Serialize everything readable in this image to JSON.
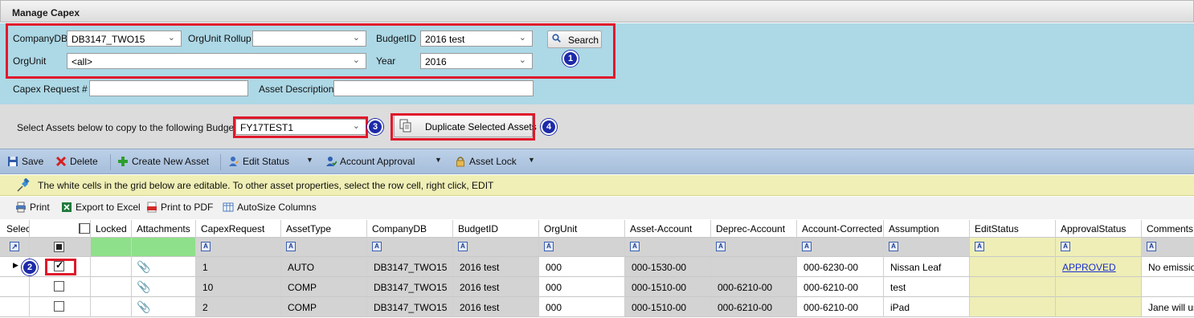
{
  "window": {
    "title": "Manage Capex"
  },
  "filters": {
    "company_db_label": "CompanyDB",
    "company_db_value": "DB3147_TWO15",
    "orgunit_rollup_label": "OrgUnit Rollup",
    "orgunit_rollup_value": "",
    "budget_id_label": "BudgetID",
    "budget_id_value": "2016 test",
    "orgunit_label": "OrgUnit",
    "orgunit_value": "<all>",
    "year_label": "Year",
    "year_value": "2016",
    "search_label": "Search",
    "capex_request_label": "Capex Request #",
    "capex_request_value": "",
    "asset_description_label": "Asset Description",
    "asset_description_value": ""
  },
  "copy": {
    "label": "Select Assets below to copy to the following BudgetID",
    "target_budget_value": "FY17TEST1",
    "duplicate_label": "Duplicate Selected Assets"
  },
  "markers": [
    "1",
    "2",
    "3",
    "4"
  ],
  "toolbar": {
    "save": "Save",
    "delete": "Delete",
    "create": "Create New Asset",
    "edit_status": "Edit Status",
    "account_approval": "Account Approval",
    "asset_lock": "Asset Lock"
  },
  "info": {
    "message": "The white cells in the grid below are editable. To other asset properties, select the row cell, right click, EDIT"
  },
  "export": {
    "print": "Print",
    "excel": "Export to Excel",
    "pdf": "Print to PDF",
    "autosize": "AutoSize Columns"
  },
  "grid": {
    "filter_glyph": "A",
    "headers": [
      "Select",
      "Locked",
      "Attachments",
      "CapexRequest",
      "AssetType",
      "CompanyDB",
      "BudgetID",
      "OrgUnit",
      "Asset-Account",
      "Deprec-Account",
      "Account-Corrected",
      "Assumption",
      "EditStatus",
      "ApprovalStatus",
      "Comments"
    ],
    "rows": [
      {
        "checked": true,
        "capex": "1",
        "type": "AUTO",
        "company": "DB3147_TWO15",
        "budget": "2016 test",
        "orgunit": "000",
        "asset_account": "000-1530-00",
        "deprec_account": "",
        "account_corrected": "000-6230-00",
        "assumption": "Nissan Leaf",
        "edit_status": "",
        "approval_status": "APPROVED",
        "comments": "No emissio"
      },
      {
        "checked": false,
        "capex": "10",
        "type": "COMP",
        "company": "DB3147_TWO15",
        "budget": "2016 test",
        "orgunit": "000",
        "asset_account": "000-1510-00",
        "deprec_account": "000-6210-00",
        "account_corrected": "000-6210-00",
        "assumption": "test",
        "edit_status": "",
        "approval_status": "",
        "comments": ""
      },
      {
        "checked": false,
        "capex": "2",
        "type": "COMP",
        "company": "DB3147_TWO15",
        "budget": "2016 test",
        "orgunit": "000",
        "asset_account": "000-1510-00",
        "deprec_account": "000-6210-00",
        "account_corrected": "000-6210-00",
        "assumption": "iPad",
        "edit_status": "",
        "approval_status": "",
        "comments": "Jane will us"
      }
    ]
  },
  "colors": {
    "annotation_red": "#e0192b",
    "marker_blue": "#1d2aa8",
    "filter_panel": "#add8e6",
    "link": "#1b2fd1"
  }
}
